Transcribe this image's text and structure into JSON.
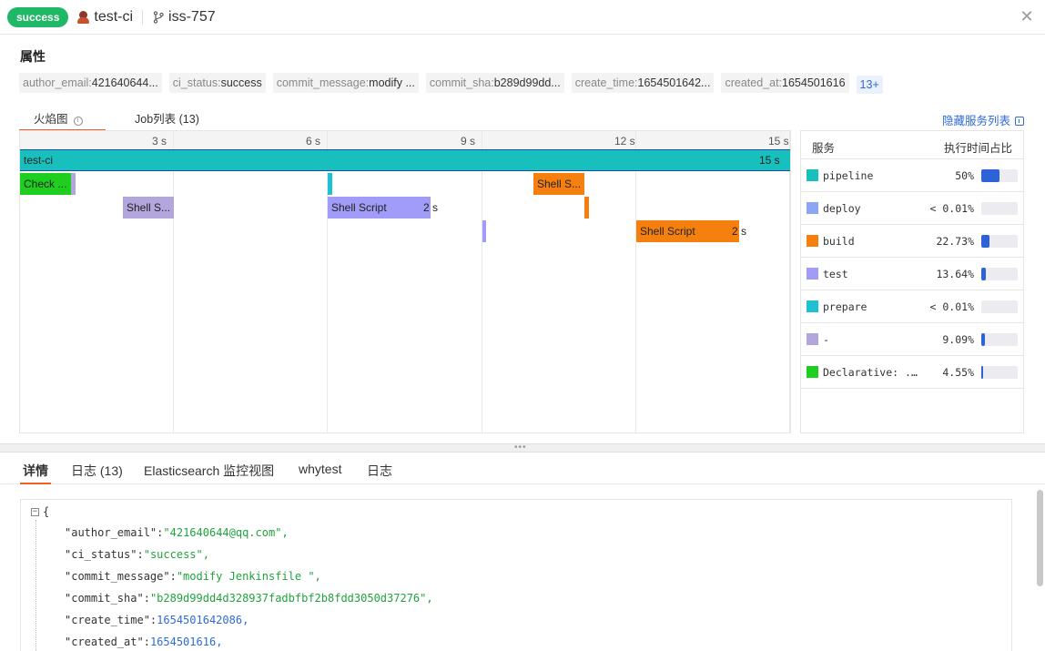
{
  "header": {
    "status": "success",
    "pipeline_name": "test-ci",
    "branch": "iss-757",
    "close_icon": "close-icon",
    "colors": {
      "status_bg": "#1fb866"
    }
  },
  "attributes": {
    "title": "属性",
    "tags": [
      {
        "key": "author_email:",
        "value": "421640644..."
      },
      {
        "key": "ci_status:",
        "value": "success"
      },
      {
        "key": "commit_message:",
        "value": "modify ..."
      },
      {
        "key": "commit_sha:",
        "value": "b289d99dd..."
      },
      {
        "key": "create_time:",
        "value": "1654501642..."
      },
      {
        "key": "created_at:",
        "value": "1654501616"
      }
    ],
    "more": "13+"
  },
  "view_tabs": {
    "flame": "火焰图",
    "jobs": "Job列表 (13)",
    "hide_services": "隐藏服务列表"
  },
  "flame": {
    "ticks": [
      "3 s",
      "6 s",
      "9 s",
      "12 s",
      "15 s"
    ],
    "bars": [
      {
        "label": "test-ci",
        "service": "pipeline",
        "start": 0,
        "end": 15,
        "depth": 0,
        "duration_label": "15 s"
      },
      {
        "label": "Check ...",
        "service": "Declarative: ...",
        "start": 0,
        "end": 1.0,
        "depth": 1,
        "duration_label": ""
      },
      {
        "label": "",
        "service": "-",
        "start": 1.0,
        "end": 1.08,
        "depth": 1,
        "duration_label": ""
      },
      {
        "label": "",
        "service": "prepare",
        "start": 6.0,
        "end": 6.08,
        "depth": 1,
        "duration_label": ""
      },
      {
        "label": "Shell S...",
        "service": "build",
        "start": 10.0,
        "end": 11.0,
        "depth": 1,
        "duration_label": ""
      },
      {
        "label": "Shell S...",
        "service": "-",
        "start": 2.0,
        "end": 3.0,
        "depth": 2,
        "duration_label": ""
      },
      {
        "label": "Shell Script",
        "service": "test",
        "start": 6.0,
        "end": 8.0,
        "depth": 2,
        "duration_label": "2 s"
      },
      {
        "label": "",
        "service": "build",
        "start": 11.0,
        "end": 11.08,
        "depth": 2,
        "duration_label": ""
      },
      {
        "label": "",
        "service": "test",
        "start": 9.0,
        "end": 9.08,
        "depth": 3,
        "duration_label": ""
      },
      {
        "label": "Shell Script",
        "service": "build",
        "start": 12.0,
        "end": 14.0,
        "depth": 3,
        "duration_label": "2 s"
      }
    ]
  },
  "services": {
    "col_service": "服务",
    "col_ratio": "执行时间占比",
    "rows": [
      {
        "name": "pipeline",
        "pct": "50%",
        "ratio": 0.5,
        "color": "#17c0bc"
      },
      {
        "name": "deploy",
        "pct": "< 0.01%",
        "ratio": 0.0,
        "color": "#8ca5f5"
      },
      {
        "name": "build",
        "pct": "22.73%",
        "ratio": 0.2273,
        "color": "#f6800f"
      },
      {
        "name": "test",
        "pct": "13.64%",
        "ratio": 0.1364,
        "color": "#a09cf7"
      },
      {
        "name": "prepare",
        "pct": "< 0.01%",
        "ratio": 0.0,
        "color": "#1ec0d2"
      },
      {
        "name": "-",
        "pct": "9.09%",
        "ratio": 0.0909,
        "color": "#b3a6dc"
      },
      {
        "name": "Declarative: ...",
        "pct": "4.55%",
        "ratio": 0.0455,
        "color": "#1fcf1f"
      }
    ]
  },
  "detail_tabs": [
    "详情",
    "日志 (13)",
    "Elasticsearch 监控视图",
    "whytest",
    "日志"
  ],
  "json_view": {
    "open": "{",
    "lines": [
      {
        "key": "\"author_email\"",
        "sep": ":",
        "value": "\"421640644@qq.com\"",
        "kind": "string",
        "end": ","
      },
      {
        "key": "\"ci_status\"",
        "sep": ":",
        "value": "\"success\"",
        "kind": "string",
        "end": ","
      },
      {
        "key": "\"commit_message\"",
        "sep": ":",
        "value": "\"modify Jenkinsfile \"",
        "kind": "string",
        "end": ","
      },
      {
        "key": "\"commit_sha\"",
        "sep": ":",
        "value": "\"b289d99dd4d328937fadbfbf2b8fdd3050d37276\"",
        "kind": "string",
        "end": ","
      },
      {
        "key": "\"create_time\"",
        "sep": ":",
        "value": "1654501642086",
        "kind": "number",
        "end": ","
      },
      {
        "key": "\"created_at\"",
        "sep": ":",
        "value": "1654501616",
        "kind": "number",
        "end": ","
      }
    ]
  }
}
